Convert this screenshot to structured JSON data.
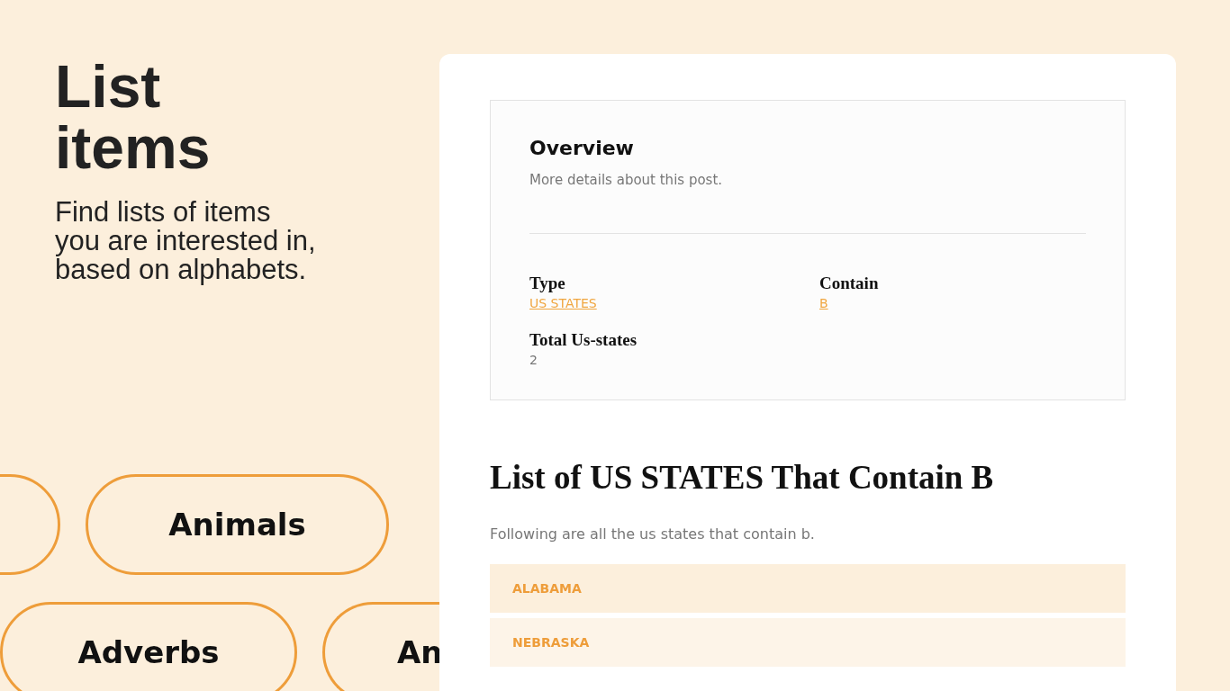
{
  "hero": {
    "title_lines": [
      "List",
      "items"
    ],
    "subtitle_lines": [
      "Find lists of items",
      "you are interested in,",
      "based on alphabets."
    ]
  },
  "pill_rows": [
    [
      {
        "kind": "blank"
      },
      {
        "kind": "label",
        "label": "Animals"
      }
    ],
    [
      {
        "kind": "label",
        "label": "Adverbs"
      },
      {
        "kind": "label",
        "label": "An"
      }
    ]
  ],
  "overview": {
    "title": "Overview",
    "subtitle": "More details about this post.",
    "fields": [
      {
        "label": "Type",
        "value": "US STATES",
        "kind": "link"
      },
      {
        "label": "Contain",
        "value": "B",
        "kind": "link"
      },
      {
        "label": "Total Us-states",
        "value": "2",
        "kind": "text"
      }
    ]
  },
  "heading": "List of US STATES That Contain B",
  "intro": "Following are all the us states that contain b.",
  "items": [
    "ALABAMA",
    "NEBRASKA"
  ]
}
